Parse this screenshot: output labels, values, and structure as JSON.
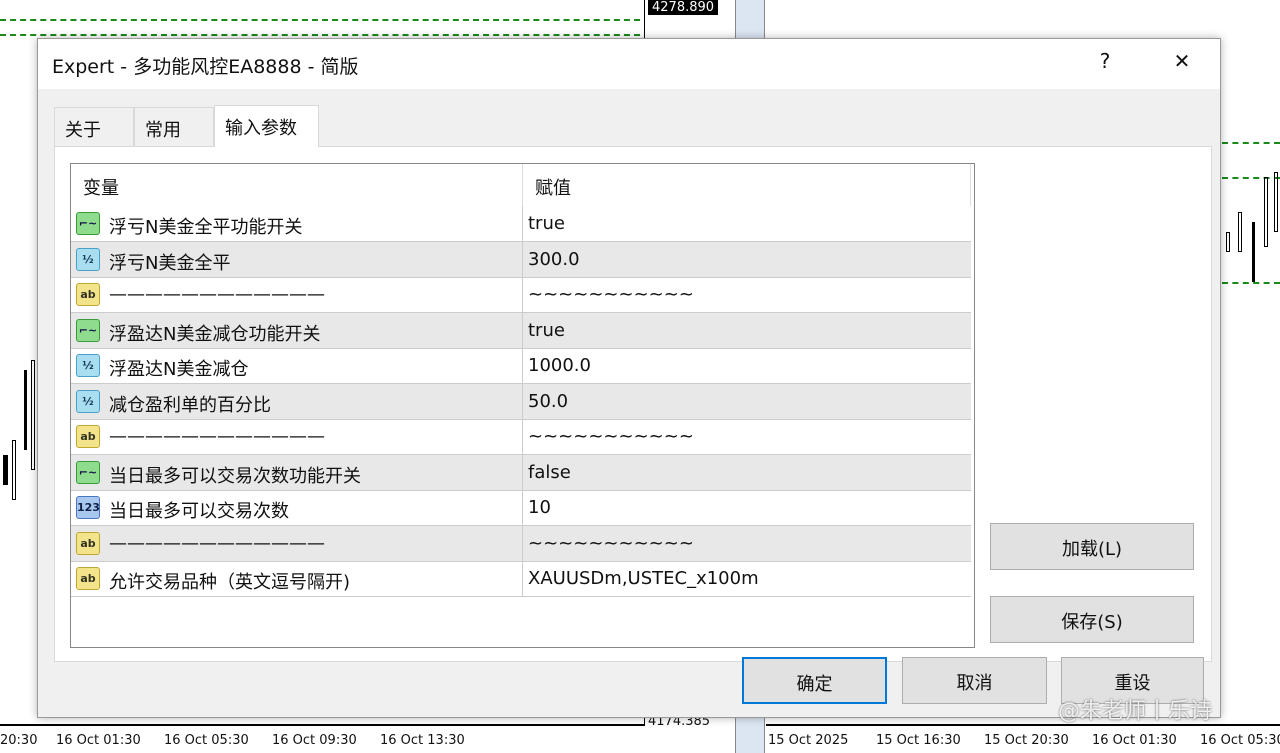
{
  "chart": {
    "price_top": "4278.890",
    "price_bottom": "4174.385",
    "left_axis": [
      "20:30",
      "16 Oct 01:30",
      "16 Oct 05:30",
      "16 Oct 09:30",
      "16 Oct 13:30"
    ],
    "right_axis": [
      "15 Oct 2025",
      "15 Oct 16:30",
      "15 Oct 20:30",
      "16 Oct 01:30",
      "16 Oct 05:30"
    ],
    "line_color": "#1a8a1a"
  },
  "dialog": {
    "title": "Expert - 多功能风控EA8888 - 简版",
    "help": "?",
    "close": "✕",
    "tabs": [
      {
        "label": "关于"
      },
      {
        "label": "常用"
      },
      {
        "label": "输入参数",
        "active": true
      }
    ],
    "table": {
      "headers": [
        "变量",
        "赋值"
      ],
      "rows": [
        {
          "icon": "bool",
          "name": "浮亏N美金全平功能开关",
          "value": "true"
        },
        {
          "icon": "double",
          "name": "浮亏N美金全平",
          "value": "300.0"
        },
        {
          "icon": "string",
          "name": "————————————",
          "value": "~~~~~~~~~~~"
        },
        {
          "icon": "bool",
          "name": "浮盈达N美金减仓功能开关",
          "value": "true"
        },
        {
          "icon": "double",
          "name": "浮盈达N美金减仓",
          "value": "1000.0"
        },
        {
          "icon": "double",
          "name": "减仓盈利单的百分比",
          "value": "50.0"
        },
        {
          "icon": "string",
          "name": "————————————",
          "value": "~~~~~~~~~~~"
        },
        {
          "icon": "bool",
          "name": "当日最多可以交易次数功能开关",
          "value": "false"
        },
        {
          "icon": "int",
          "name": "当日最多可以交易次数",
          "value": "10"
        },
        {
          "icon": "string",
          "name": "————————————",
          "value": "~~~~~~~~~~~"
        },
        {
          "icon": "string",
          "name": "允许交易品种（英文逗号隔开)",
          "value": "XAUUSDm,USTEC_x100m"
        }
      ]
    },
    "buttons": {
      "load": "加载(L)",
      "save": "保存(S)",
      "ok": "确定",
      "cancel": "取消",
      "reset": "重设"
    }
  },
  "watermark": "@朱老师丨乐诗"
}
